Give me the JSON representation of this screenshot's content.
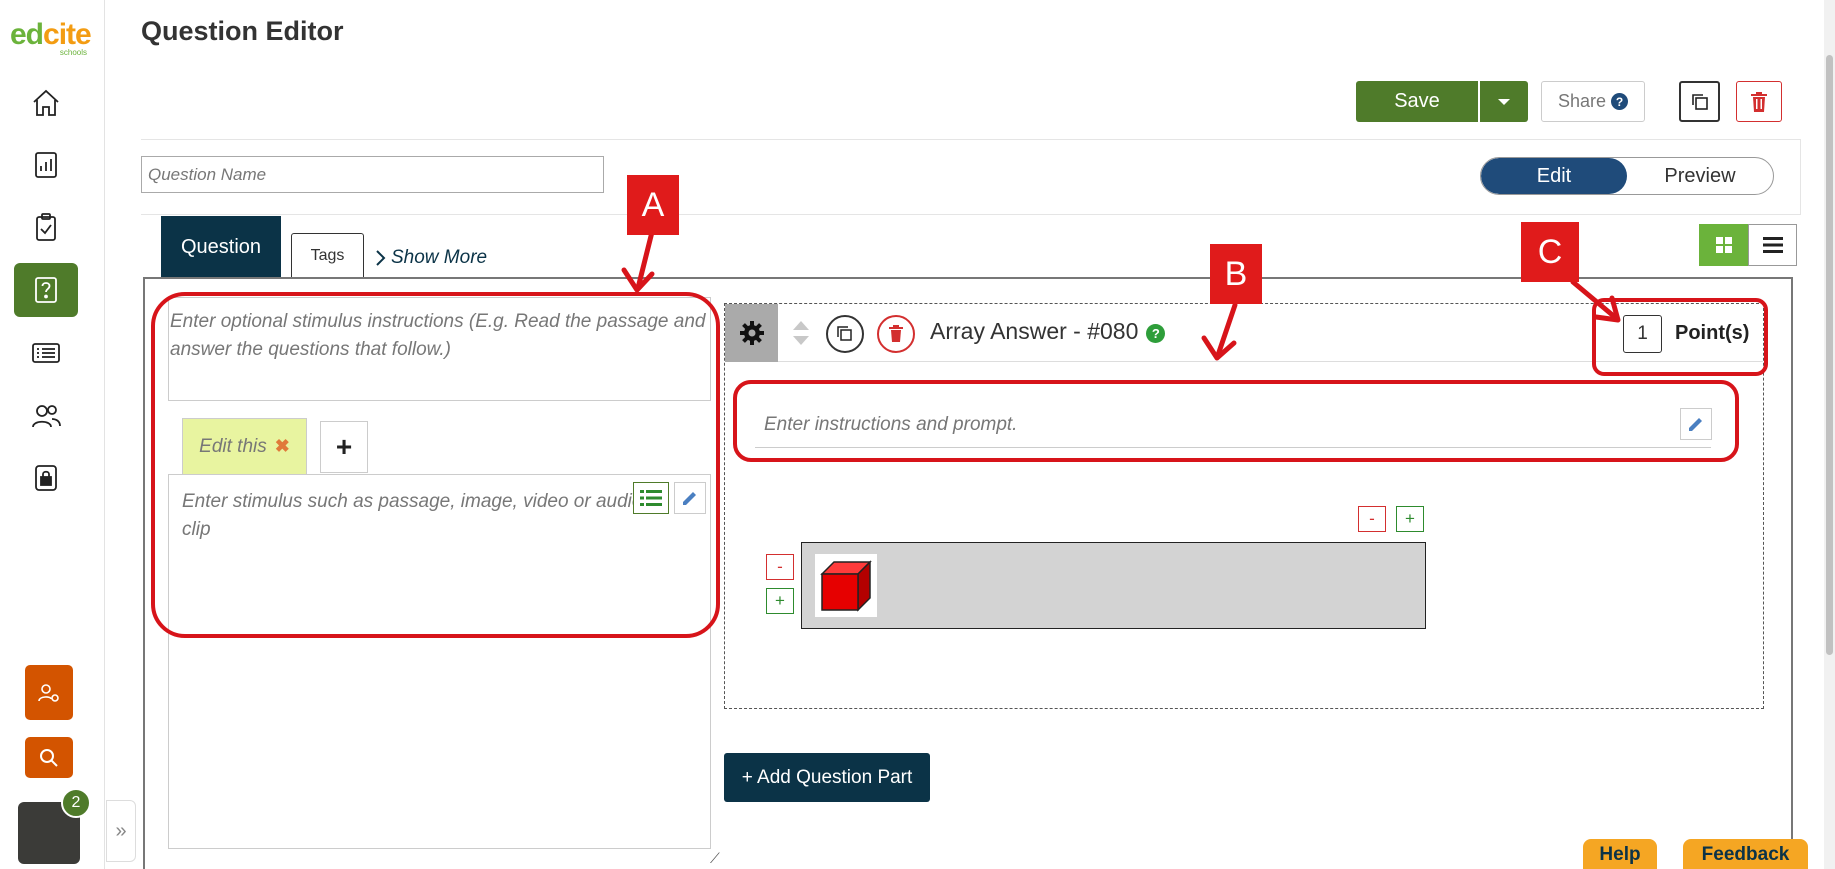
{
  "app": {
    "logo_main": "edcite",
    "logo_sub": "schools",
    "notification_count": "2"
  },
  "sidebar": {
    "items": [
      {
        "name": "home",
        "icon": "home-icon"
      },
      {
        "name": "reports",
        "icon": "bar-chart-icon"
      },
      {
        "name": "assignments",
        "icon": "clipboard-check-icon"
      },
      {
        "name": "questions",
        "icon": "question-box-icon",
        "active": true
      },
      {
        "name": "lists",
        "icon": "list-icon"
      },
      {
        "name": "users",
        "icon": "users-icon"
      },
      {
        "name": "security",
        "icon": "lock-icon"
      }
    ]
  },
  "header": {
    "title": "Question Editor",
    "save_label": "Save",
    "share_label": "Share",
    "share_help": "?"
  },
  "toolbar": {
    "question_name_placeholder": "Question Name",
    "toggle_edit": "Edit",
    "toggle_preview": "Preview"
  },
  "tabs": {
    "question": "Question",
    "tags": "Tags",
    "show_more": "Show More"
  },
  "stimulus": {
    "instructions_placeholder": "Enter optional stimulus instructions (E.g. Read the passage and answer the questions that follow.)",
    "tab_label": "Edit this",
    "tab_close": "✖",
    "add_tab": "+",
    "content_placeholder": "Enter stimulus such as passage, image, video or audio clip"
  },
  "question_part": {
    "title": "Array Answer - #080",
    "help": "?",
    "points_value": "1",
    "points_label": "Point(s)",
    "prompt_placeholder": "Enter instructions and prompt.",
    "minus": "-",
    "plus": "+"
  },
  "actions": {
    "add_part": "+ Add Question Part",
    "help": "Help",
    "feedback": "Feedback"
  },
  "annotations": {
    "a": "A",
    "b": "B",
    "c": "C",
    "color": "#d7141a"
  },
  "colors": {
    "brand_green": "#4f7b2a",
    "navy": "#0b3347",
    "accent_blue": "#1f4b7a",
    "orange": "#d35400",
    "help_yellow": "#f5a623"
  }
}
